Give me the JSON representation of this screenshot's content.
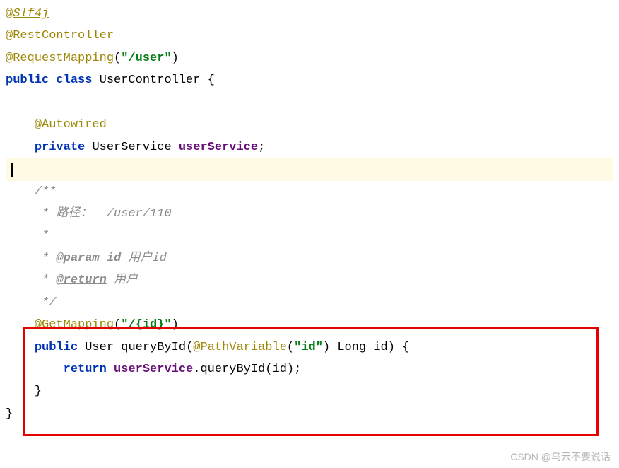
{
  "code": {
    "line1_at": "@",
    "line1_slf4j": "Slf4j",
    "line2": "@RestController",
    "line3_anno": "@RequestMapping",
    "line3_paren_open": "(",
    "line3_quote1": "\"",
    "line3_path": "/user",
    "line3_quote2": "\"",
    "line3_paren_close": ")",
    "line4_public": "public ",
    "line4_class": "class ",
    "line4_name": "UserController {",
    "line6_indent": "    ",
    "line6_anno": "@Autowired",
    "line7_indent": "    ",
    "line7_private": "private ",
    "line7_type": "UserService ",
    "line7_field": "userService",
    "line7_semi": ";",
    "line9_indent": "    ",
    "line9_comment": "/**",
    "line10_indent": "     ",
    "line10_star": "* ",
    "line10_text": "路径：  /user/110",
    "line11_indent": "     ",
    "line11_star": "*",
    "line12_indent": "     ",
    "line12_star": "* ",
    "line12_tag": "@param",
    "line12_space": " ",
    "line12_param": "id",
    "line12_desc": " 用户id",
    "line13_indent": "     ",
    "line13_star": "* ",
    "line13_tag": "@return",
    "line13_desc": " 用户",
    "line14_indent": "     ",
    "line14_close": "*/",
    "line15_indent": "    ",
    "line15_anno": "@GetMapping",
    "line15_paren_open": "(",
    "line15_quote1": "\"",
    "line15_path": "/{id}",
    "line15_quote2": "\"",
    "line15_paren_close": ")",
    "line16_indent": "    ",
    "line16_public": "public ",
    "line16_type": "User ",
    "line16_method": "queryById",
    "line16_paren_open": "(",
    "line16_anno": "@PathVariable",
    "line16_paren2_open": "(",
    "line16_quote1": "\"",
    "line16_id": "id",
    "line16_quote2": "\"",
    "line16_paren2_close": ") ",
    "line16_long": "Long ",
    "line16_param": "id) {",
    "line17_indent": "        ",
    "line17_return": "return ",
    "line17_field": "userService",
    "line17_dot": ".",
    "line17_method": "queryById",
    "line17_call": "(id);",
    "line18_indent": "    ",
    "line18_brace": "}",
    "line19_brace": "}"
  },
  "watermark": "CSDN @乌云不要说话"
}
